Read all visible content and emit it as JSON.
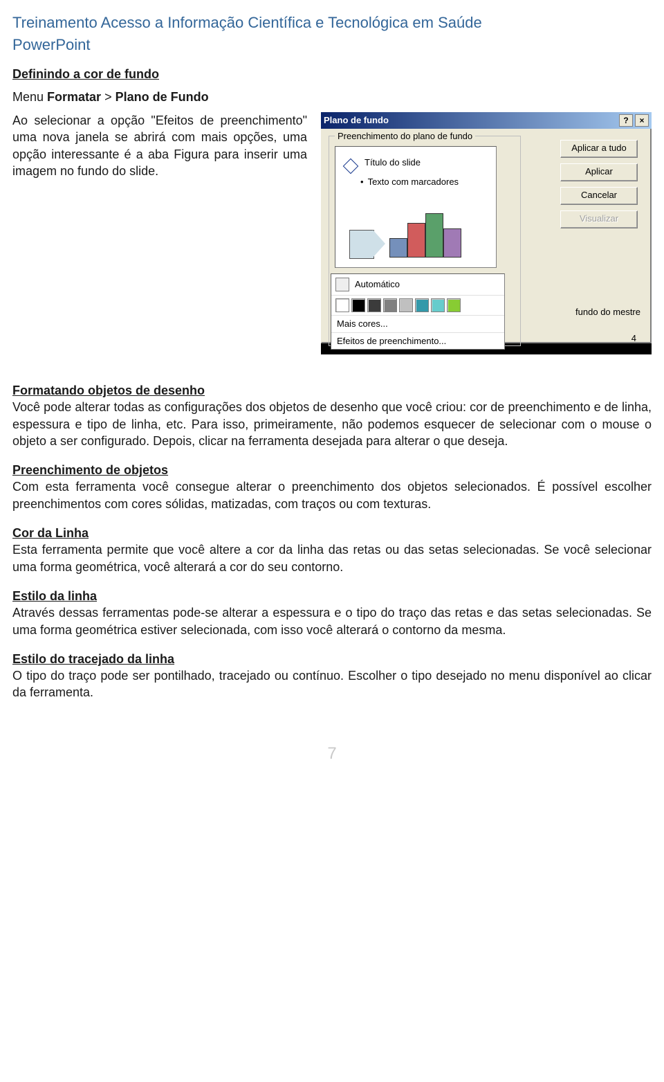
{
  "header": {
    "line1": "Treinamento Acesso a Informação Científica e Tecnológica em Saúde",
    "line2": "PowerPoint"
  },
  "sec1": {
    "title": "Definindo a cor de fundo",
    "breadcrumb_prefix": "Menu ",
    "breadcrumb_a": "Formatar",
    "breadcrumb_sep": " > ",
    "breadcrumb_b": "Plano de Fundo",
    "para": "Ao selecionar a opção \"Efeitos de preenchimento\" uma nova janela se abrirá com mais opções, uma opção interessante é a aba Figura para inserir uma imagem no fundo do slide."
  },
  "dialog": {
    "title": "Plano de fundo",
    "legend": "Preenchimento do plano de fundo",
    "preview_title": "Título do slide",
    "preview_bullet": "Texto com marcadores",
    "btn_apply_all": "Aplicar a tudo",
    "btn_apply": "Aplicar",
    "btn_cancel": "Cancelar",
    "btn_preview": "Visualizar",
    "auto_label": "Automático",
    "more_colors": "Mais cores...",
    "fill_effects": "Efeitos de preenchimento...",
    "master_label": "fundo do mestre",
    "slide_idx": "4",
    "swatches": [
      "#ffffff",
      "#000000",
      "#3b3b3b",
      "#808080",
      "#c0c0c0",
      "#3399aa",
      "#66cccc",
      "#88cc33"
    ]
  },
  "sec2": {
    "h1": "Formatando objetos de desenho",
    "p1": "Você pode alterar todas as configurações dos objetos de desenho que você criou: cor de preenchimento e de linha, espessura e tipo de linha, etc. Para isso, primeiramente, não podemos esquecer de selecionar com o mouse o objeto a ser configurado. Depois, clicar na ferramenta desejada para alterar o que deseja.",
    "h2": "Preenchimento de objetos",
    "p2": "Com esta ferramenta você consegue alterar o preenchimento dos objetos selecionados. É possível escolher preenchimentos com cores sólidas, matizadas, com traços ou com texturas.",
    "h3": "Cor da Linha",
    "p3": "Esta ferramenta permite que você altere a cor da linha das retas ou das setas selecionadas. Se você selecionar uma forma geométrica, você alterará a cor do seu contorno.",
    "h4": "Estilo da linha",
    "p4": "Através dessas ferramentas pode-se alterar a espessura e o tipo do traço das retas e das setas selecionadas. Se uma forma geométrica estiver selecionada, com isso você alterará o contorno da mesma.",
    "h5": "Estilo do tracejado da linha",
    "p5": "O tipo do traço pode ser pontilhado, tracejado ou contínuo. Escolher o tipo desejado no menu disponível ao clicar da ferramenta."
  },
  "page_number": "7"
}
